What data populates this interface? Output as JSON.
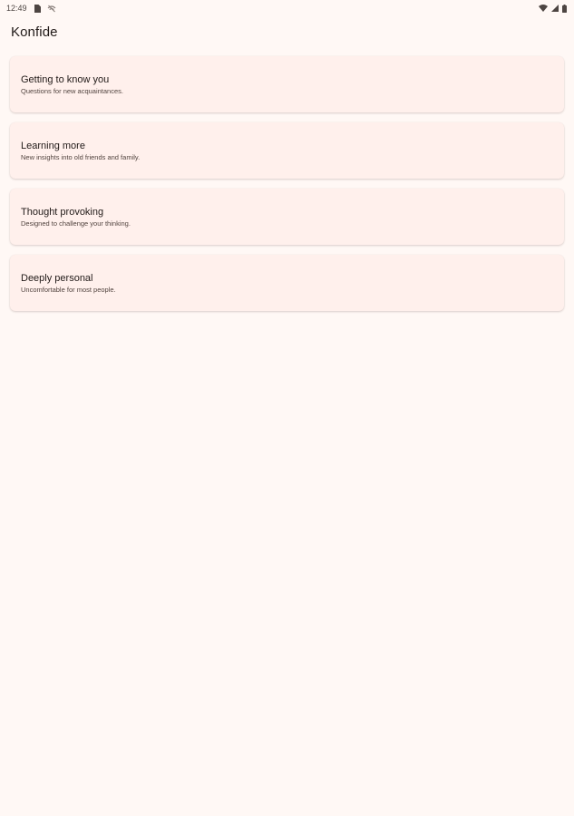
{
  "status_bar": {
    "time": "12:49",
    "icons": [
      "sim-card-icon",
      "no-signal-icon",
      "wifi-icon",
      "cellular-signal-icon",
      "battery-icon"
    ]
  },
  "app": {
    "title": "Konfide"
  },
  "categories": [
    {
      "title": "Getting to know you",
      "subtitle": "Questions for new acquaintances."
    },
    {
      "title": "Learning more",
      "subtitle": "New insights into old friends and family."
    },
    {
      "title": "Thought provoking",
      "subtitle": "Designed to challenge your thinking."
    },
    {
      "title": "Deeply personal",
      "subtitle": "Uncomfortable for most people."
    }
  ],
  "colors": {
    "background": "#fff8f5",
    "card": "#fff0ec",
    "text_primary": "#211a18",
    "text_secondary": "#52443f"
  }
}
